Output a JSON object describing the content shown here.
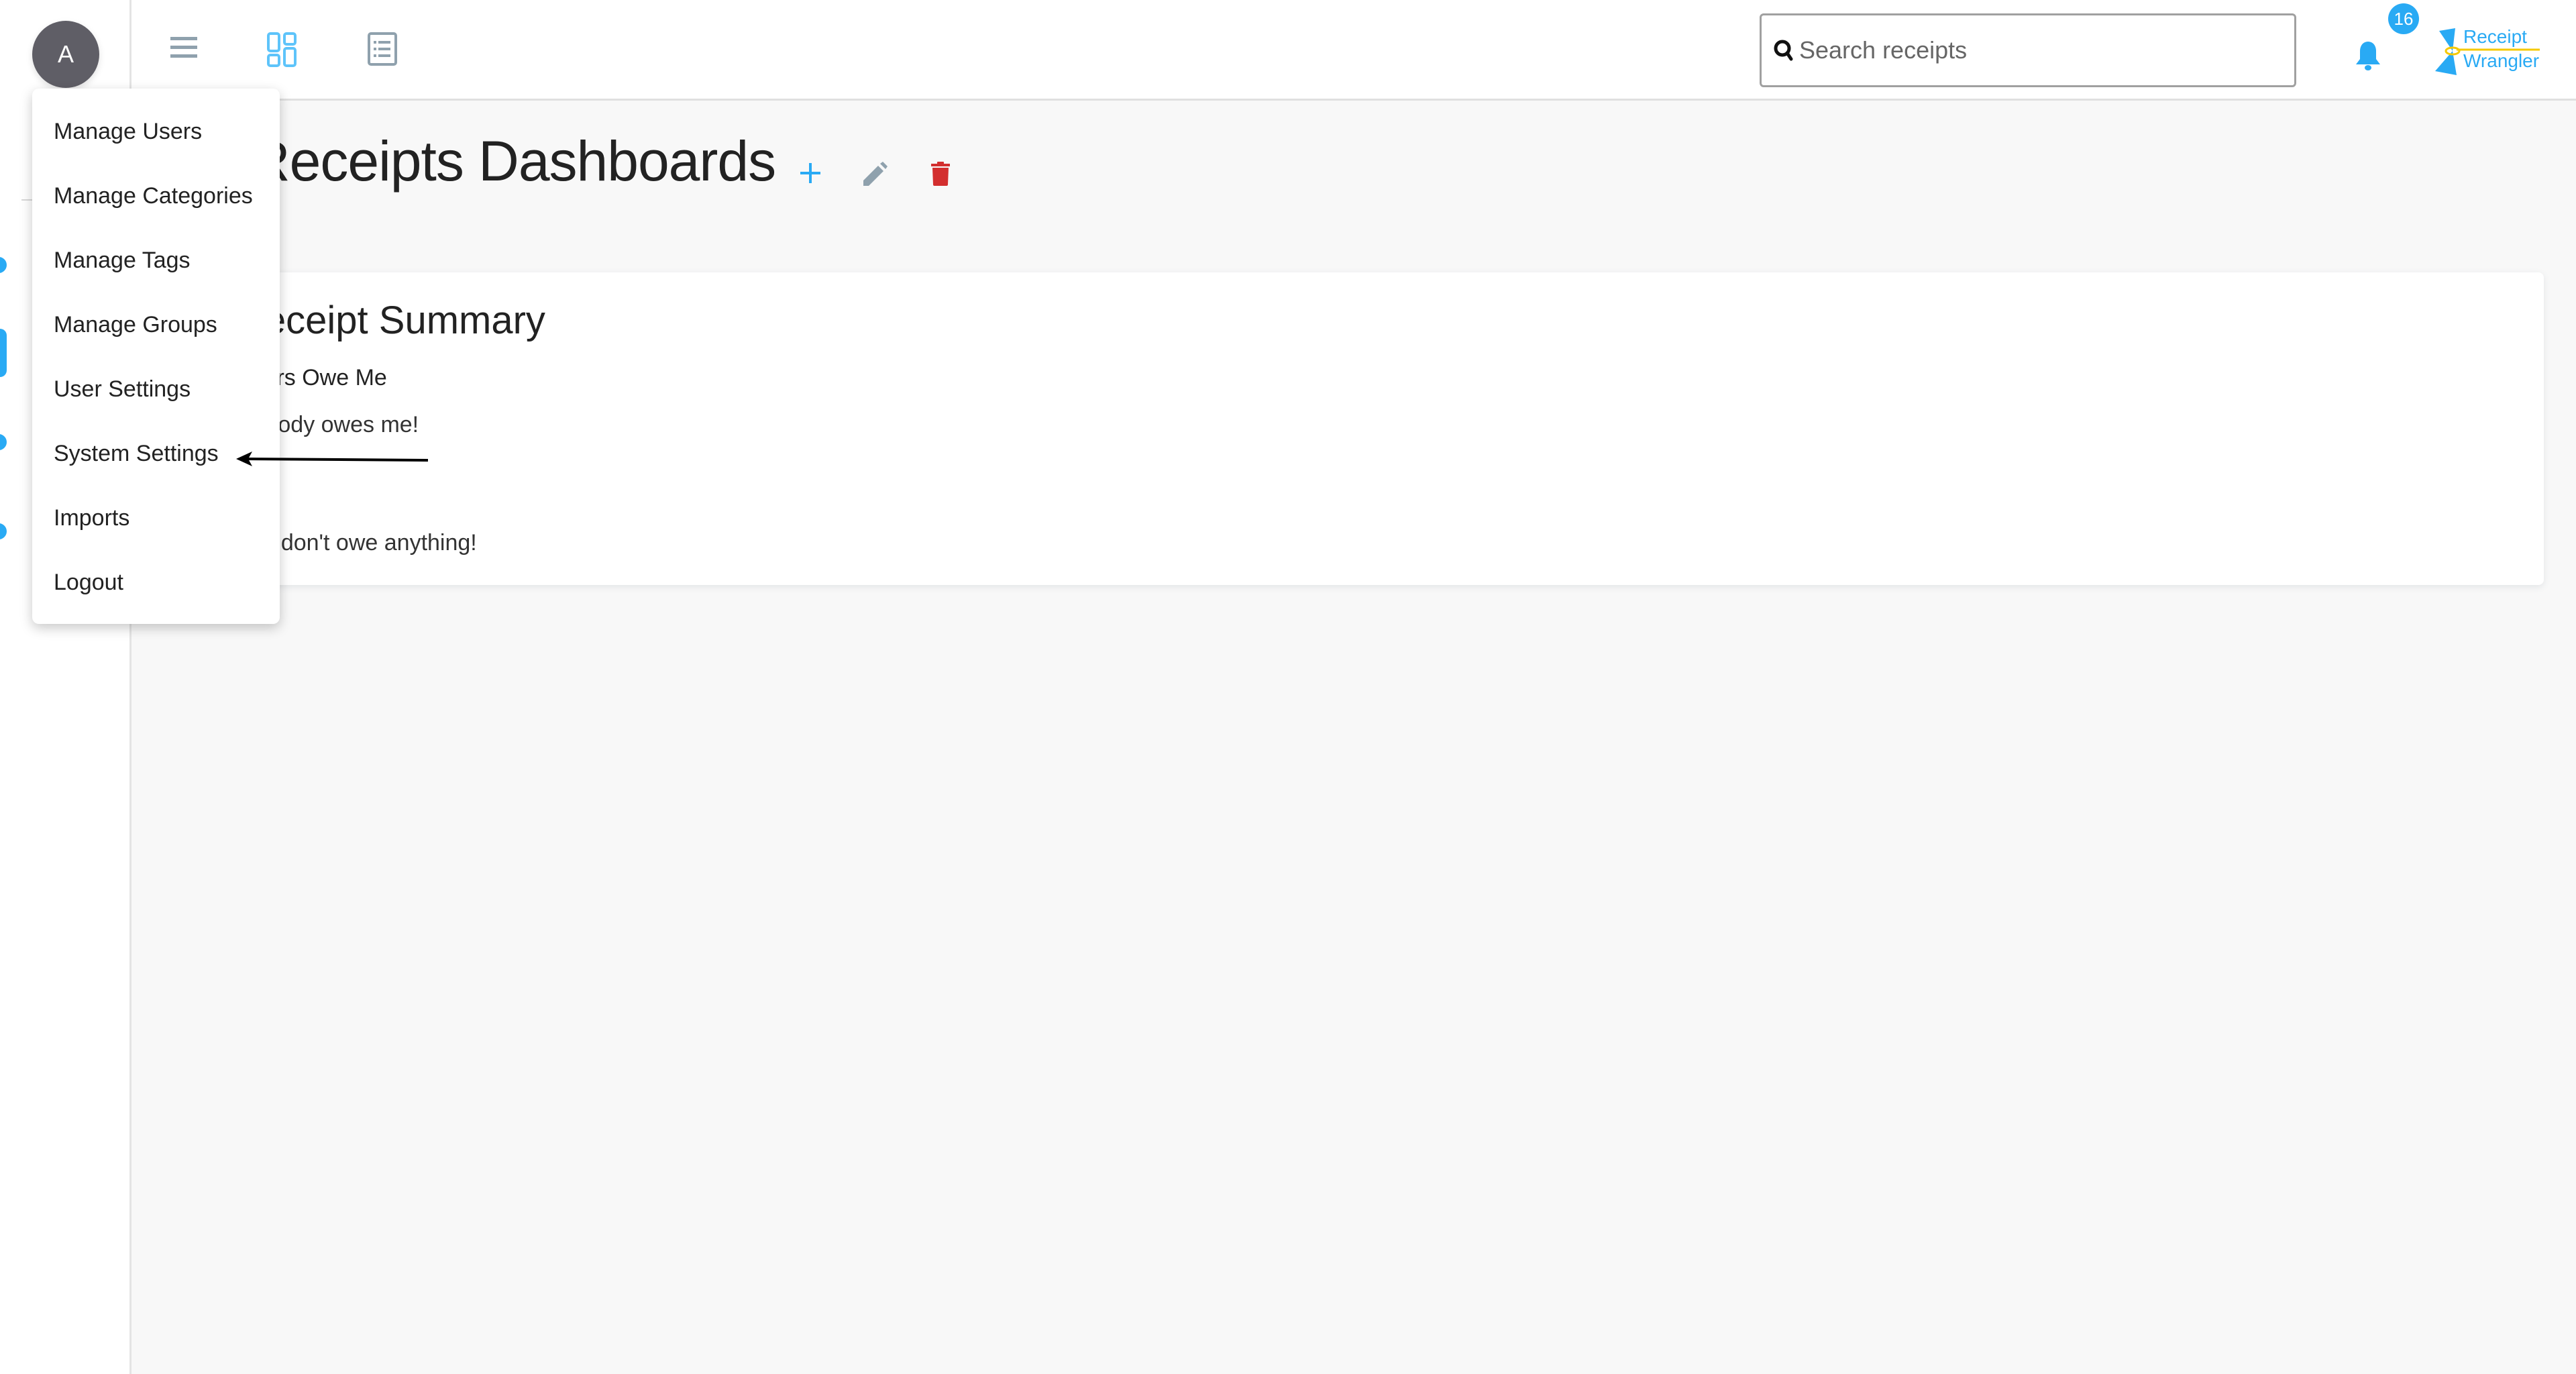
{
  "app": {
    "name": "Receipt Wrangler",
    "logo_line1": "Receipt",
    "logo_line2": "Wrangler"
  },
  "user": {
    "avatar_initial": "A"
  },
  "colors": {
    "accent": "#29aaf4",
    "icon_gray": "#8fa1ad",
    "danger": "#d32f2f",
    "avatar_bg": "#5f5e66",
    "logo_accent": "#f5c900"
  },
  "topbar": {
    "search": {
      "placeholder": "Search receipts",
      "value": ""
    },
    "notifications_count": "16"
  },
  "user_menu": {
    "items": [
      {
        "label": "Manage Users"
      },
      {
        "label": "Manage Categories"
      },
      {
        "label": "Manage Tags"
      },
      {
        "label": "Manage Groups"
      },
      {
        "label": "User Settings"
      },
      {
        "label": "System Settings"
      },
      {
        "label": "Imports"
      },
      {
        "label": "Logout"
      }
    ]
  },
  "page": {
    "title": "Receipts Dashboards",
    "actions": {
      "add": "add-dashboard",
      "edit": "edit-dashboard",
      "delete": "delete-dashboard"
    }
  },
  "summary_card": {
    "title": "Receipt Summary",
    "section_owed_to_me": "Users Owe Me",
    "owed_to_me_text": "Nobody owes me!",
    "i_owe_text": "You don't owe anything!"
  },
  "annotation": {
    "target": "System Settings"
  }
}
